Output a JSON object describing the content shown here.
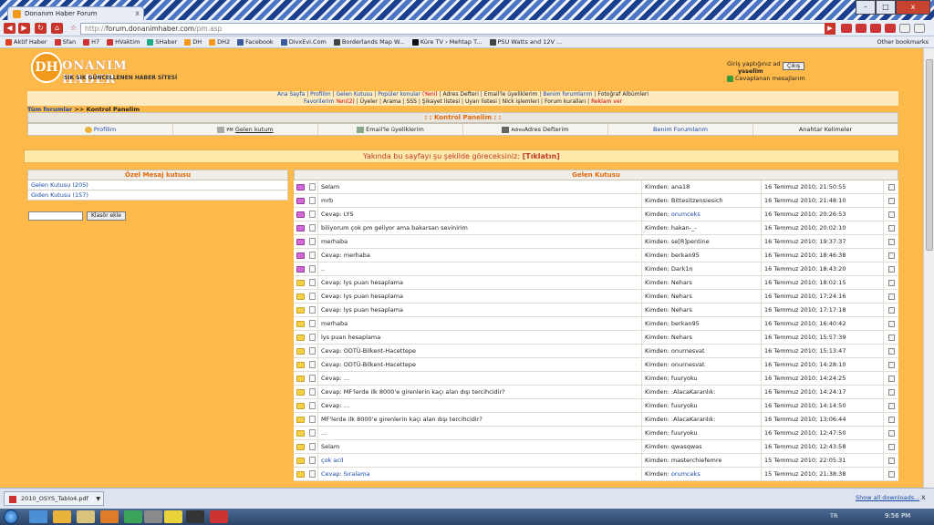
{
  "browser": {
    "tab_title": "Donanım Haber Forum",
    "tab_close": "x",
    "url_prefix": "http://",
    "url_main": "forum.donanimhaber.com",
    "url_path": "/pm.asp",
    "window_controls": {
      "minimize": "–",
      "maximize": "□",
      "close": "x"
    }
  },
  "bookmarks": {
    "items": [
      {
        "label": "Aktif Haber",
        "color": "#d9441f"
      },
      {
        "label": "Sfan",
        "color": "#c33"
      },
      {
        "label": "H7",
        "color": "#c33"
      },
      {
        "label": "HVaktim",
        "color": "#c33"
      },
      {
        "label": "SHaber",
        "color": "#2a8"
      },
      {
        "label": "DH",
        "color": "#f39a1c"
      },
      {
        "label": "DH2",
        "color": "#f39a1c"
      },
      {
        "label": "Facebook",
        "color": "#3b5998"
      },
      {
        "label": "DivxEvi.Com",
        "color": "#3b5998"
      },
      {
        "label": "Borderlands Map W...",
        "color": "#444"
      },
      {
        "label": "Küre TV › Mehtap T...",
        "color": "#111"
      },
      {
        "label": "PSU Watts and 12V ...",
        "color": "#444"
      }
    ],
    "other": "Other bookmarks"
  },
  "header": {
    "logo_letter": "DH",
    "logo_name": "ONANIM HABER",
    "logo_slogan": "SIK SIK GÜNCELLENEN HABER SİTESİ",
    "login_text": "Giriş yaptığınız ad",
    "username": "ysselim",
    "logout_label": "Çıkış",
    "unanswered_label": "Cevaplanan mesajlarım"
  },
  "topnav": {
    "row1": [
      "Ana Sayfa",
      "Profilim",
      "Gelen Kutusu",
      "Popüler konular",
      "Adres Defteri",
      "Email'le üyeliklerim",
      "Benim forumlarım",
      "Fotoğraf Albümleri"
    ],
    "new_tag": "(Yeni)",
    "row2": [
      "Favorilerim",
      "Üyeler",
      "Arama",
      "SSS",
      "Şikayet listesi",
      "Uyarı listesi",
      "Nick işlemleri",
      "Forum kuralları",
      "Reklam ver"
    ],
    "fav_tag": "Yeni(2)"
  },
  "breadcrumb": {
    "link": "Tüm forumlar",
    "sep": ">>",
    "current": "Kontrol Panelim"
  },
  "control_panel": {
    "title": ": : Kontrol Panelim : :",
    "tabs": [
      "Profilim",
      "Gelen kutum",
      "Email'le üyeliklerim",
      "Adres Defterim",
      "Benim Forumlarım",
      "Anahtar Kelimeler"
    ],
    "pm_prefix": "PM",
    "addr_prefix": "Adres"
  },
  "notice": {
    "text": "Yakında bu sayfayı şu şekilde göreceksiniz:",
    "link": "[Tıklatın]"
  },
  "pm_sidebar": {
    "title": "Özel Mesaj kutusu",
    "inbox": "Gelen Kutusu (205)",
    "outbox": "Giden Kutusu (157)",
    "folder_button": "Klasör ekle"
  },
  "inbox": {
    "title": "Gelen Kutusu",
    "from_prefix": "Kimden:",
    "rows": [
      {
        "subject": "Selam",
        "from": "ana18",
        "date": "16 Temmuz 2010; 21:50:55",
        "unread": true
      },
      {
        "subject": "mrb",
        "from": "Bittesitzensiesich",
        "date": "16 Temmuz 2010; 21:48:10",
        "unread": true
      },
      {
        "subject": "Cevap: LYS",
        "from": "orumceks",
        "date": "16 Temmuz 2010; 20:26:53",
        "unread": true,
        "blue_from": true
      },
      {
        "subject": "biliyorum çok pm geliyor ama bakarsan sevinirim",
        "from": "hakan-_-",
        "date": "16 Temmuz 2010; 20:02:10",
        "unread": true
      },
      {
        "subject": "merhaba",
        "from": "se[R]pentine",
        "date": "16 Temmuz 2010; 19:37:37",
        "unread": true
      },
      {
        "subject": "Cevap: merhaba",
        "from": "berkan95",
        "date": "16 Temmuz 2010; 18:46:38",
        "unread": true
      },
      {
        "subject": "..",
        "from": "Dark1n",
        "date": "16 Temmuz 2010; 18:43:20",
        "unread": true
      },
      {
        "subject": "Cevap: lys puan hesaplama",
        "from": "Nehars",
        "date": "16 Temmuz 2010; 18:02:15",
        "unread": false
      },
      {
        "subject": "Cevap: lys puan hesaplama",
        "from": "Nehars",
        "date": "16 Temmuz 2010; 17:24:16",
        "unread": false
      },
      {
        "subject": "Cevap: lys puan hesaplama",
        "from": "Nehars",
        "date": "16 Temmuz 2010; 17:17:18",
        "unread": false
      },
      {
        "subject": "merhaba",
        "from": "berkan95",
        "date": "16 Temmuz 2010; 16:40:42",
        "unread": false
      },
      {
        "subject": "lys puan hesaplama",
        "from": "Nehars",
        "date": "16 Temmuz 2010; 15:57:39",
        "unread": false
      },
      {
        "subject": "Cevap: ODTÜ-Bilkent-Hacettepe",
        "from": "onurnesvat",
        "date": "16 Temmuz 2010; 15:13:47",
        "unread": false
      },
      {
        "subject": "Cevap: ODTÜ-Bilkent-Hacettepe",
        "from": "onurnesvat",
        "date": "16 Temmuz 2010; 14:28:10",
        "unread": false
      },
      {
        "subject": "Cevap: ...",
        "from": "fuuryoku",
        "date": "16 Temmuz 2010; 14:24:25",
        "unread": false
      },
      {
        "subject": "Cevap: MF'lerde ilk 8000'e girenlerin kaçı alan dışı tercihcidir?",
        "from": ":AlacaKaranlık:",
        "date": "16 Temmuz 2010; 14:24:17",
        "unread": false
      },
      {
        "subject": "Cevap: ...",
        "from": "fuuryoku",
        "date": "16 Temmuz 2010; 14:14:50",
        "unread": false
      },
      {
        "subject": "MF'lerde ilk 8000'e girenlerin kaçı alan dışı tercihcidir?",
        "from": ":AlacaKaranlık:",
        "date": "16 Temmuz 2010; 13:06:44",
        "unread": false
      },
      {
        "subject": "...",
        "from": "fuuryoku",
        "date": "16 Temmuz 2010; 12:47:50",
        "unread": false
      },
      {
        "subject": "Selam",
        "from": "qwasqwas",
        "date": "16 Temmuz 2010; 12:43:58",
        "unread": false
      },
      {
        "subject": "çok acil",
        "from": "masterchiefemre",
        "date": "15 Temmuz 2010; 22:05:31",
        "unread": false,
        "blue_subject": true
      },
      {
        "subject": "Cevap: Sıralama",
        "from": "orumceks",
        "date": "15 Temmuz 2010; 21:38:38",
        "unread": false,
        "blue_subject": true,
        "blue_from": true
      }
    ]
  },
  "downloads": {
    "file": "2010_OSYS_Tablo4.pdf",
    "show_all": "Show all downloads...",
    "close": "x"
  },
  "taskbar": {
    "lang": "TR",
    "time": "9:56 PM"
  }
}
